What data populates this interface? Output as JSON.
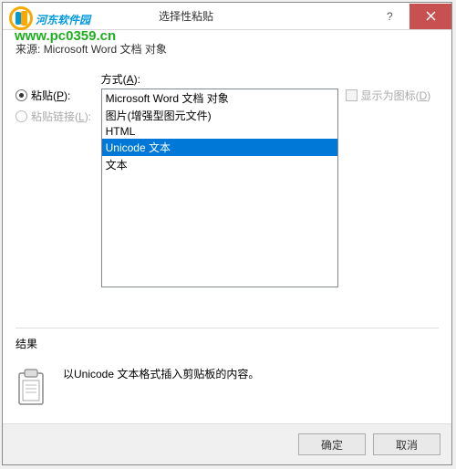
{
  "watermark": {
    "line1": "河东软件园",
    "line2": "www.pc0359.cn"
  },
  "title": "选择性粘贴",
  "source": {
    "label": "来源:",
    "value": "Microsoft Word 文档 对象"
  },
  "paste_radio": {
    "label": "粘贴(P):",
    "selected": true
  },
  "paste_link_radio": {
    "label": "粘贴链接(L):",
    "selected": false,
    "enabled": false
  },
  "method_label": "方式(A):",
  "list": {
    "items": [
      "Microsoft Word 文档 对象",
      "图片(增强型图元文件)",
      "HTML",
      "Unicode 文本",
      "文本"
    ],
    "selected_index": 3
  },
  "show_icon": {
    "label": "显示为图标(D)",
    "checked": false,
    "enabled": false
  },
  "result": {
    "heading": "结果",
    "text": "以Unicode 文本格式插入剪贴板的内容。"
  },
  "buttons": {
    "ok": "确定",
    "cancel": "取消"
  }
}
